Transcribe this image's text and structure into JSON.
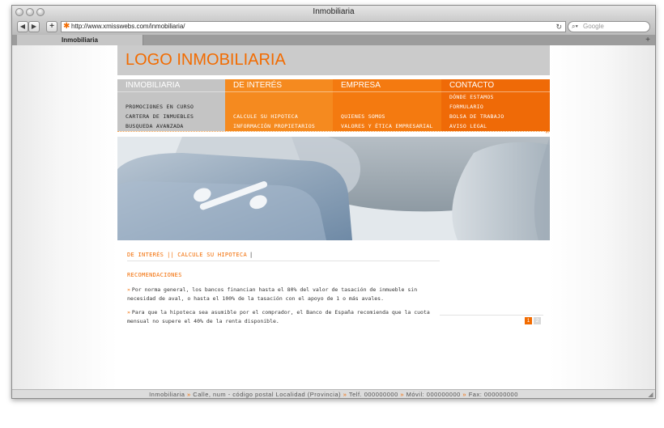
{
  "window": {
    "title": "Inmobiliaria"
  },
  "toolbar": {
    "back_icon": "◀",
    "forward_icon": "▶",
    "add_icon": "+",
    "url": "http://www.xmisswebs.com/inmobiliaria/",
    "reload_icon": "↻",
    "search_placeholder": "Google"
  },
  "tabs": [
    {
      "label": "Inmobiliaria"
    }
  ],
  "site": {
    "logo": "LOGO INMOBILIARIA",
    "menu": [
      {
        "label": "INMOBILIARIA",
        "items": [
          "PROMOCIONES EN CURSO",
          "CARTERA DE INMUEBLES",
          "BUSQUEDA AVANZADA"
        ]
      },
      {
        "label": "DE INTERÉS",
        "items": [
          "CALCULE SU HIPOTECA",
          "INFORMACIÓN PROPIETARIOS"
        ]
      },
      {
        "label": "EMPRESA",
        "items": [
          "QUIENES SOMOS",
          "VALORES Y ÉTICA EMPRESARIAL"
        ]
      },
      {
        "label": "CONTACTO",
        "items": [
          "DÓNDE ESTAMOS",
          "FORMULARIO",
          "BOLSA DE TRABAJO",
          "AVISO LEGAL"
        ]
      }
    ],
    "breadcrumb": {
      "first": "DE INTERÉS",
      "separator": "||",
      "second": "CALCULE SU HIPOTECA",
      "end": "|"
    },
    "section_title": "RECOMENDACIONES",
    "paragraphs": [
      "Por norma general, los bancos financian hasta el 80% del valor de tasación de inmueble sin necesidad de aval, o hasta el 100% de la tasación con el apoyo de 1 o más avales.",
      "Para que la hipoteca sea asumible por el comprador, el Banco de España recomienda que la cuota mensual no supere el 40% de la renta disponible."
    ],
    "pager": [
      "1",
      "2"
    ],
    "footer": {
      "name": "Inmobiliaria",
      "address": "Calle, num - código postal Localidad (Provincia)",
      "tel": "Telf. 000000000",
      "movil": "Móvil: 000000000",
      "fax": "Fax: 000000000"
    }
  },
  "colors": {
    "accent": "#f26b00",
    "menu_gray": "#c4c4c4",
    "menu_orange_1": "#f58a1f",
    "menu_orange_2": "#f47a10",
    "menu_orange_3": "#ef6a07"
  }
}
